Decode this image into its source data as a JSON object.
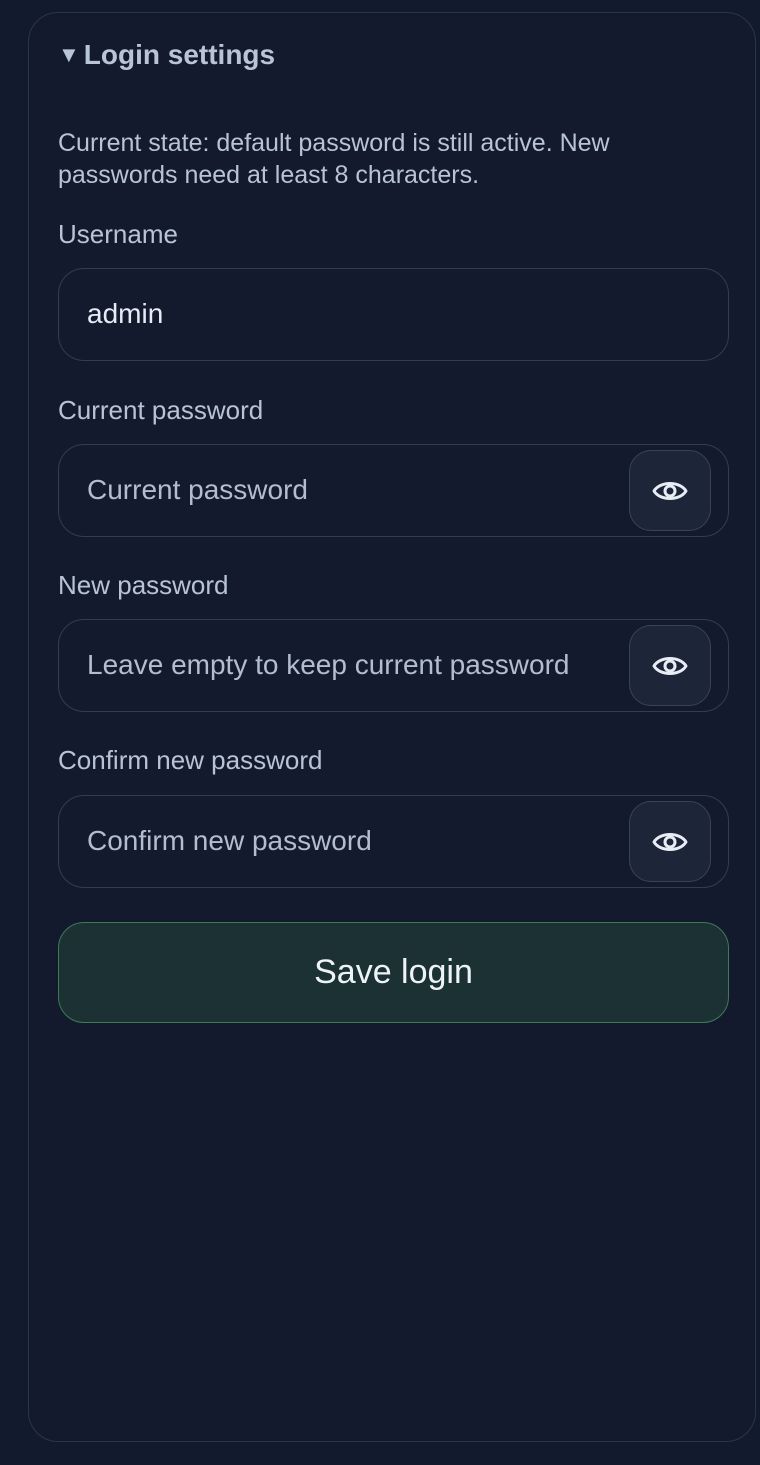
{
  "section": {
    "toggle_glyph": "▼",
    "title": "Login settings",
    "intro": "Current state: default password is still active. New passwords need at least 8 characters."
  },
  "username": {
    "label": "Username",
    "value": "admin",
    "placeholder": ""
  },
  "current_password": {
    "label": "Current password",
    "value": "",
    "placeholder": "Current password",
    "toggle_icon": "eye-icon"
  },
  "new_password": {
    "label": "New password",
    "value": "",
    "placeholder": "Leave empty to keep current password",
    "toggle_icon": "eye-icon"
  },
  "confirm_password": {
    "label": "Confirm new password",
    "value": "",
    "placeholder": "Confirm new password",
    "toggle_icon": "eye-icon"
  },
  "save_button": {
    "label": "Save login"
  },
  "colors": {
    "background": "#121a2e",
    "panel_border": "#2c3548",
    "save_bg": "#1b3134",
    "save_border": "#3f7a55"
  }
}
